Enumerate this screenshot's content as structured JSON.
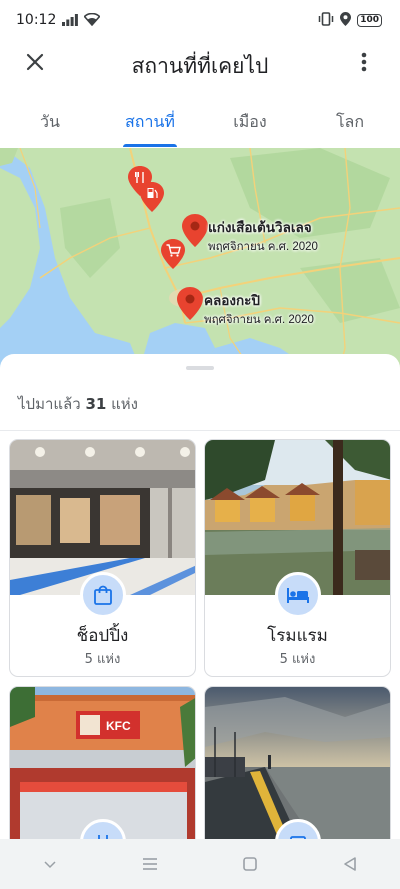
{
  "status_bar": {
    "time": "10:12",
    "battery": "100",
    "icons": [
      "signal-icon",
      "wifi-icon",
      "vibrate-icon",
      "location-icon",
      "battery-icon"
    ]
  },
  "app_bar": {
    "title": "สถานที่ที่เคยไป",
    "close_icon": "close-icon",
    "more_icon": "more-vert-icon"
  },
  "tabs": [
    {
      "label": "วัน",
      "active": false
    },
    {
      "label": "สถานที่",
      "active": true
    },
    {
      "label": "เมือง",
      "active": false
    },
    {
      "label": "โลก",
      "active": false
    }
  ],
  "map": {
    "pins": [
      {
        "title": "แก่งเสือเต้นวิลเลจ",
        "date": "พฤศจิกายน ค.ศ. 2020"
      },
      {
        "title": "คลองกะปิ",
        "date": "พฤศจิกายน ค.ศ. 2020"
      }
    ],
    "colors": {
      "land": "#c4e2b0",
      "water": "#a4d0f5",
      "road": "#f3d27a",
      "pin": "#e8432f"
    }
  },
  "sheet": {
    "summary_prefix": "ไปมาแล้ว",
    "summary_count": "31",
    "summary_suffix": "แห่ง",
    "cards": [
      {
        "title": "ช็อปปิ้ง",
        "count": "5 แห่ง",
        "icon": "shopping-bag-icon"
      },
      {
        "title": "โรมแรม",
        "count": "5 แห่ง",
        "icon": "hotel-bed-icon"
      },
      {
        "title": "",
        "count": "",
        "icon": "restaurant-icon"
      },
      {
        "title": "",
        "count": "",
        "icon": "landmark-icon"
      }
    ]
  },
  "accent_color": "#1a73e8",
  "nav_bar": {
    "icons": [
      "chevron-down-icon",
      "menu-icon",
      "home-square-icon",
      "back-triangle-icon"
    ]
  }
}
